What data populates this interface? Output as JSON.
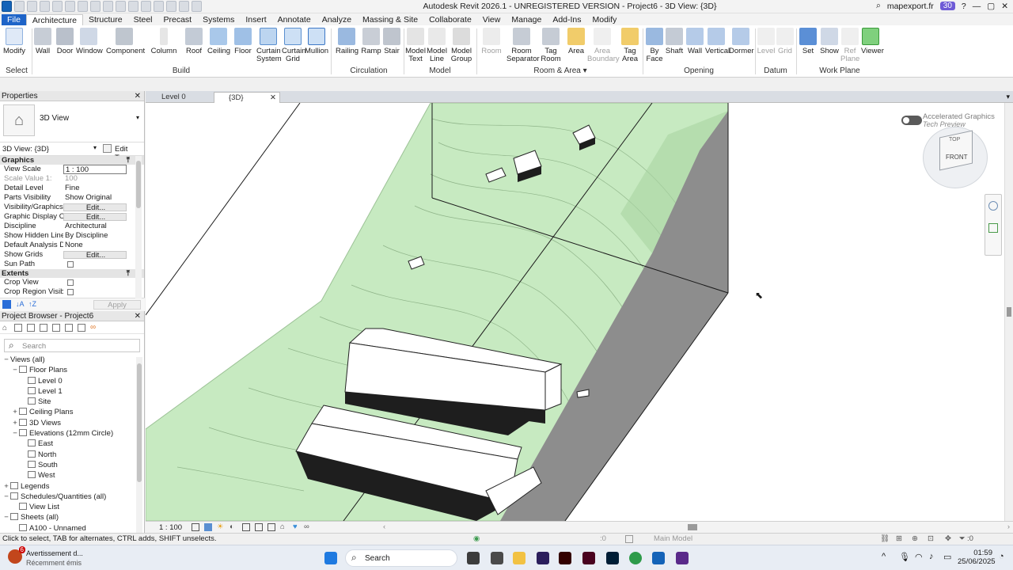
{
  "app": {
    "title": "Autodesk Revit 2026.1 - UNREGISTERED VERSION - Project6 - 3D View: {3D}"
  },
  "account": {
    "user": "mapexport.fr",
    "badge": "30"
  },
  "tabs": [
    "File",
    "Architecture",
    "Structure",
    "Steel",
    "Precast",
    "Systems",
    "Insert",
    "Annotate",
    "Analyze",
    "Massing & Site",
    "Collaborate",
    "View",
    "Manage",
    "Add-Ins",
    "Modify"
  ],
  "ribbon": {
    "select": {
      "modify": "Modify",
      "select": "Select"
    },
    "build": [
      "Wall",
      "Door",
      "Window",
      "Component",
      "Column",
      "Roof",
      "Ceiling",
      "Floor",
      "Curtain System",
      "Curtain Grid",
      "Mullion"
    ],
    "circulation": [
      "Railing",
      "Ramp",
      "Stair"
    ],
    "model": [
      "Model Text",
      "Model Line",
      "Model Group"
    ],
    "room_area": [
      "Room",
      "Room Separator",
      "Tag Room",
      "Area",
      "Area Boundary",
      "Tag Area"
    ],
    "opening": [
      "By Face",
      "Shaft",
      "Wall",
      "Vertical",
      "Dormer"
    ],
    "datum": [
      "Level",
      "Grid"
    ],
    "work_plane": [
      "Set",
      "Show",
      "Ref Plane",
      "Viewer"
    ],
    "panels": {
      "select": "Select",
      "build": "Build",
      "circulation": "Circulation",
      "model": "Model",
      "room_area": "Room & Area",
      "opening": "Opening",
      "datum": "Datum",
      "work_plane": "Work Plane"
    }
  },
  "properties": {
    "title": "Properties",
    "type": "3D View",
    "instance": "3D View: {3D}",
    "edit_type": "Edit Type",
    "sections": {
      "graphics": "Graphics",
      "extents": "Extents"
    },
    "rows": [
      {
        "k": "View Scale",
        "v": "1 : 100"
      },
      {
        "k": "Scale Value   1:",
        "v": "100"
      },
      {
        "k": "Detail Level",
        "v": "Fine"
      },
      {
        "k": "Parts Visibility",
        "v": "Show Original"
      },
      {
        "k": "Visibility/Graphics ...",
        "v": "Edit..."
      },
      {
        "k": "Graphic Display Op...",
        "v": "Edit..."
      },
      {
        "k": "Discipline",
        "v": "Architectural"
      },
      {
        "k": "Show Hidden Lines",
        "v": "By Discipline"
      },
      {
        "k": "Default Analysis Di...",
        "v": "None"
      },
      {
        "k": "Show Grids",
        "v": "Edit..."
      },
      {
        "k": "Sun Path",
        "v": ""
      }
    ],
    "extents": [
      {
        "k": "Crop View",
        "v": ""
      },
      {
        "k": "Crop Region Visible",
        "v": ""
      }
    ],
    "apply": "Apply"
  },
  "browser": {
    "title": "Project Browser - Project6",
    "search_placeholder": "Search",
    "items": [
      {
        "label": "Views (all)",
        "depth": 0,
        "tg": "−"
      },
      {
        "label": "Floor Plans",
        "depth": 1,
        "tg": "−"
      },
      {
        "label": "Level 0",
        "depth": 2,
        "tg": ""
      },
      {
        "label": "Level 1",
        "depth": 2,
        "tg": ""
      },
      {
        "label": "Site",
        "depth": 2,
        "tg": ""
      },
      {
        "label": "Ceiling Plans",
        "depth": 1,
        "tg": "+"
      },
      {
        "label": "3D Views",
        "depth": 1,
        "tg": "+"
      },
      {
        "label": "Elevations (12mm Circle)",
        "depth": 1,
        "tg": "−"
      },
      {
        "label": "East",
        "depth": 2,
        "tg": ""
      },
      {
        "label": "North",
        "depth": 2,
        "tg": ""
      },
      {
        "label": "South",
        "depth": 2,
        "tg": ""
      },
      {
        "label": "West",
        "depth": 2,
        "tg": ""
      },
      {
        "label": "Legends",
        "depth": 0,
        "tg": "+"
      },
      {
        "label": "Schedules/Quantities (all)",
        "depth": 0,
        "tg": "−"
      },
      {
        "label": "View List",
        "depth": 1,
        "tg": ""
      },
      {
        "label": "Sheets (all)",
        "depth": 0,
        "tg": "−"
      },
      {
        "label": "A100 - Unnamed",
        "depth": 1,
        "tg": ""
      }
    ]
  },
  "view_tabs": [
    {
      "label": "Level 0"
    },
    {
      "label": "{3D}"
    }
  ],
  "viewport": {
    "accel_title": "Accelerated Graphics",
    "accel_sub": "Tech Preview",
    "cube_top": "TOP",
    "cube_front": "FRONT"
  },
  "view_controls": {
    "scale": "1 : 100",
    "model": "Main Model"
  },
  "status": {
    "hint": "Click to select, TAB for alternates, CTRL adds, SHIFT unselects.",
    "sel_count": ":0",
    "filter_count": ":0"
  },
  "taskbar": {
    "notif_title": "Avertissement d...",
    "notif_sub": "Récemment émis",
    "notif_badge": "6",
    "search": "Search",
    "time": "01:59",
    "date": "25/06/2025"
  }
}
